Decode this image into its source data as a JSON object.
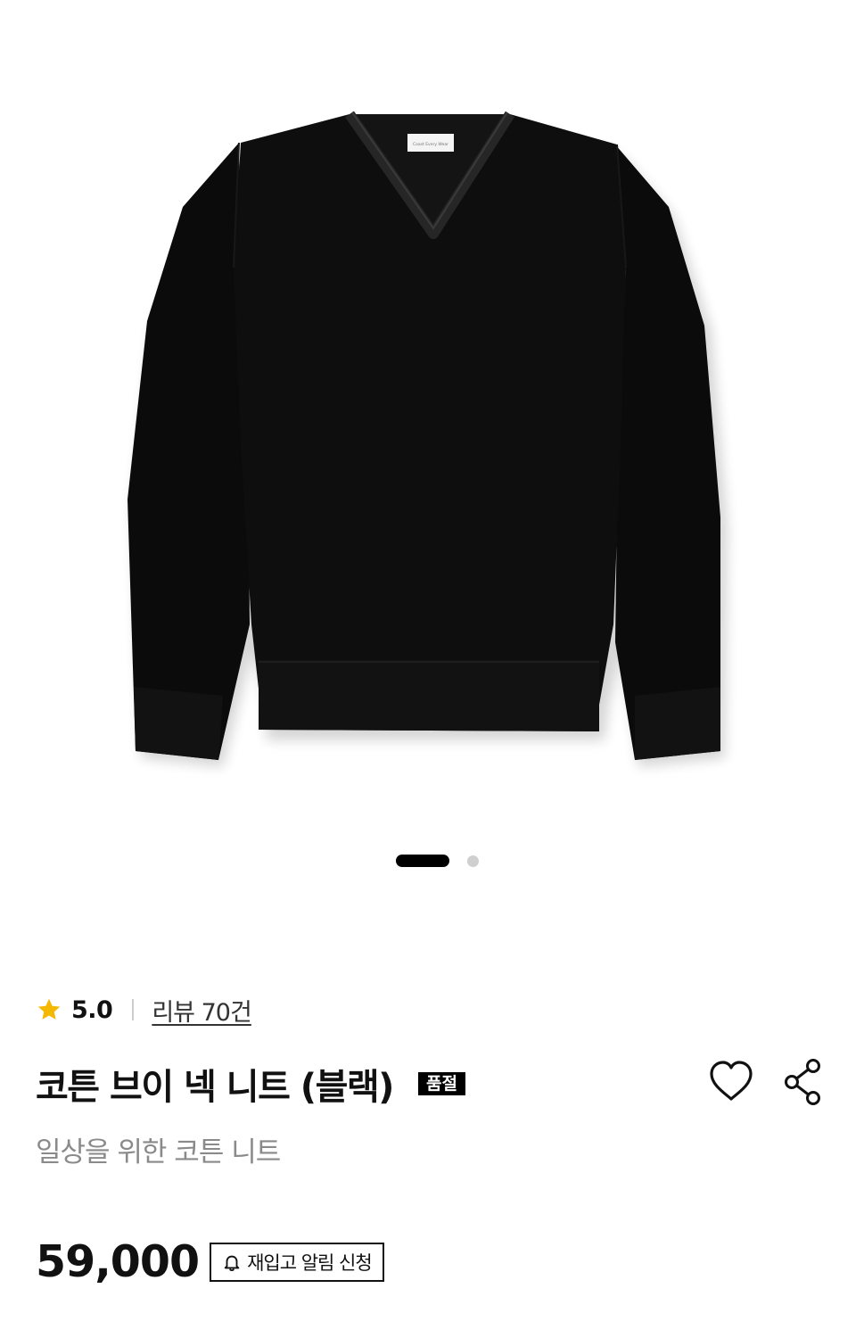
{
  "gallery": {
    "slide_count": 2,
    "active_index": 0,
    "image_label_text": "Coast Every Wear"
  },
  "rating": {
    "score": "5.0",
    "review_link": "리뷰 70건",
    "star_color": "#F5B800"
  },
  "product": {
    "title": "코튼 브이 넥 니트 (블랙)",
    "badge": "품절",
    "subtitle": "일상을 위한 코튼 니트",
    "price": "59,000"
  },
  "actions": {
    "wishlist_icon": "heart-icon",
    "share_icon": "share-icon",
    "restock_label": "재입고 알림 신청",
    "restock_icon": "bell-icon"
  }
}
